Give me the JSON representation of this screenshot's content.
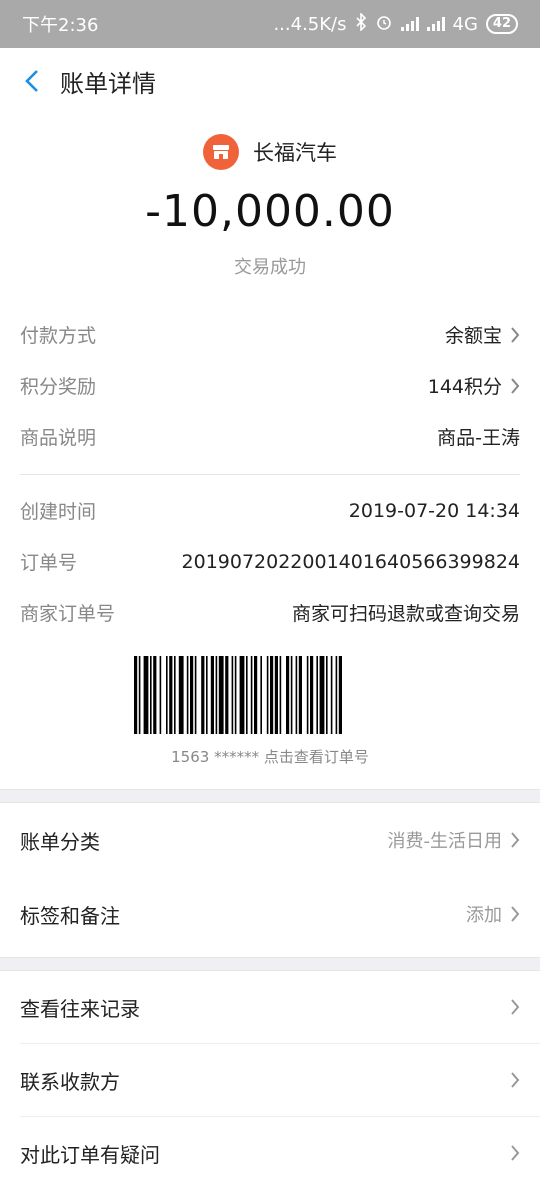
{
  "status_bar": {
    "time": "下午2:36",
    "speed": "...4.5K/s",
    "network": "4G",
    "battery": "42"
  },
  "header": {
    "title": "账单详情"
  },
  "merchant": {
    "name": "长福汽车"
  },
  "transaction": {
    "amount": "-10,000.00",
    "status": "交易成功"
  },
  "details": [
    {
      "label": "付款方式",
      "value": "余额宝",
      "link": true
    },
    {
      "label": "积分奖励",
      "value": "144积分",
      "link": true
    },
    {
      "label": "商品说明",
      "value": "商品-王涛",
      "link": false
    }
  ],
  "order": [
    {
      "label": "创建时间",
      "value": "2019-07-20 14:34"
    },
    {
      "label": "订单号",
      "value": "2019072022001401640566399824"
    },
    {
      "label": "商家订单号",
      "value": "商家可扫码退款或查询交易"
    }
  ],
  "barcode": {
    "caption": "1563 ****** 点击查看订单号"
  },
  "category": {
    "label": "账单分类",
    "value": "消费-生活日用"
  },
  "tags": {
    "label": "标签和备注",
    "value": "添加"
  },
  "actions": [
    "查看往来记录",
    "联系收款方",
    "对此订单有疑问"
  ]
}
